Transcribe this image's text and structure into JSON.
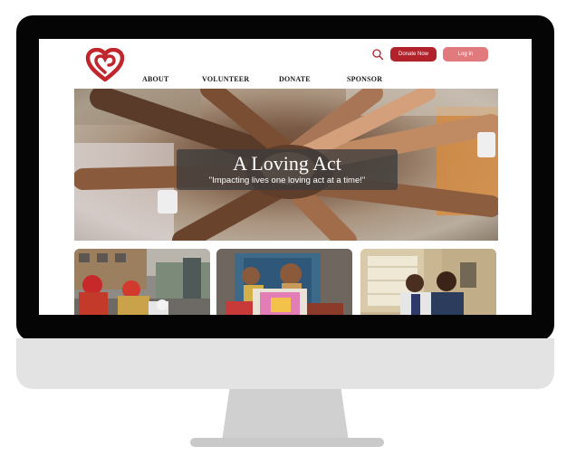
{
  "nav": {
    "items": [
      "ABOUT",
      "VOLUNTEER",
      "DONATE",
      "SPONSOR"
    ]
  },
  "header": {
    "search_icon": "search-icon",
    "donate_label": "Donate Now",
    "login_label": "Log In"
  },
  "hero": {
    "title": "A Loving Act",
    "subtitle": "\"Impacting lives one loving act at a time!\""
  },
  "colors": {
    "brand_red": "#b2222a",
    "login_pink": "#e07a7d"
  }
}
